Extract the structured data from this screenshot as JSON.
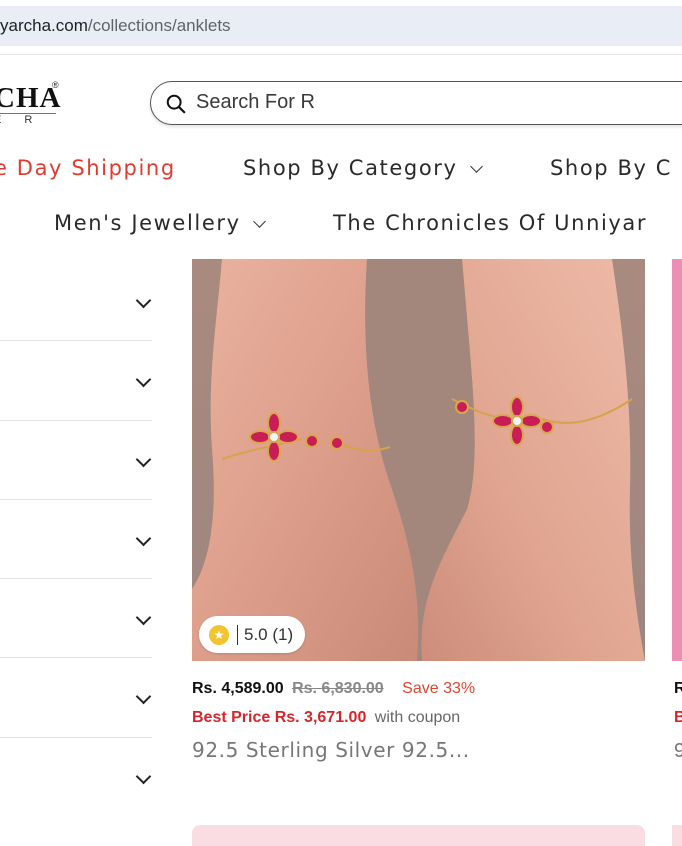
{
  "browser": {
    "url_host": "yarcha.com",
    "url_path": "/collections/anklets"
  },
  "header": {
    "logo_text": "CHA",
    "logo_registered": "®",
    "logo_sub": "E R",
    "search_placeholder": "Search For R"
  },
  "nav": {
    "row1": [
      {
        "label": "e Day Shipping",
        "highlight": true,
        "has_dropdown": false
      },
      {
        "label": "Shop By Category",
        "highlight": false,
        "has_dropdown": true
      },
      {
        "label": "Shop By C",
        "highlight": false,
        "has_dropdown": false
      }
    ],
    "row2": [
      {
        "label": "Men's Jewellery",
        "has_dropdown": true
      },
      {
        "label": "The Chronicles Of Unniyar",
        "has_dropdown": false
      }
    ]
  },
  "filters": {
    "count": 7,
    "icon": "chevron-down-icon"
  },
  "product": {
    "rating_icon": "star-icon",
    "rating": "5.0 (1)",
    "price": "Rs. 4,589.00",
    "compare_price": "Rs. 6,830.00",
    "save": "Save 33%",
    "best_price": "Best Price Rs. 3,671.00",
    "coupon_note": "with coupon",
    "title": "92.5 Sterling Silver 92.5..."
  },
  "partial_card": {
    "price_initial": "R",
    "best_initial": "B",
    "title_initial": "9"
  },
  "colors": {
    "accent_red": "#e23a2e",
    "best_price_red": "#d7262b",
    "star_gold": "#f2c430",
    "card_pink": "#fadde2"
  }
}
